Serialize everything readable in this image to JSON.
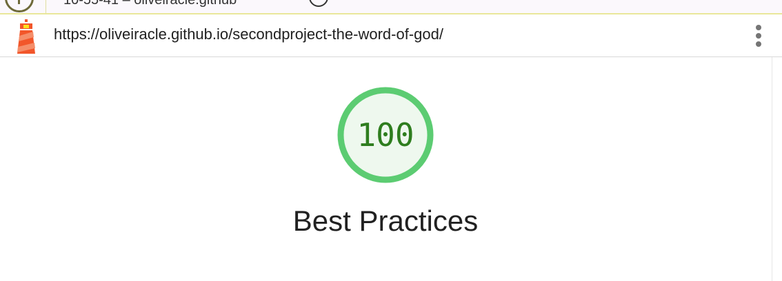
{
  "browser_top": {
    "partial_text": "10-55-41 – oliveiracle.github"
  },
  "report_header": {
    "logo_icon": "lighthouse-icon",
    "url": "https://oliveiracle.github.io/secondproject-the-word-of-god/",
    "menu_icon": "kebab-menu-icon"
  },
  "score": {
    "category": "Best Practices",
    "value": "100",
    "fraction": 1.0,
    "colors": {
      "ring": "#5ccc72",
      "fill": "#eef8ee",
      "text": "#2e7d1e"
    }
  }
}
